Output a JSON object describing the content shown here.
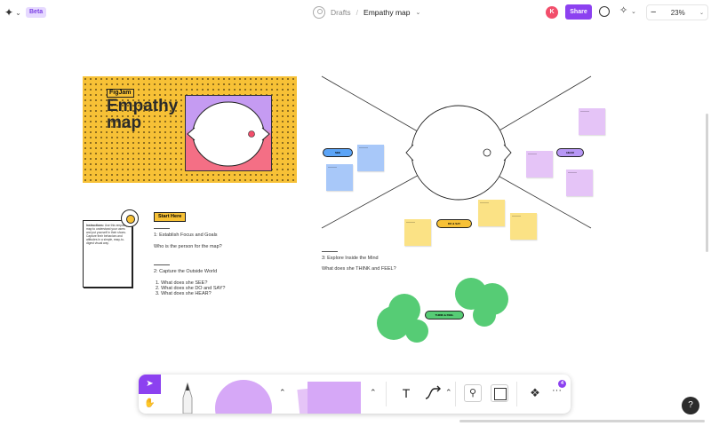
{
  "topbar": {
    "beta": "Beta",
    "breadcrumb": {
      "drafts": "Drafts",
      "separator": "/",
      "title": "Empathy map"
    },
    "user_initial": "K",
    "share": "Share",
    "zoom": "23%"
  },
  "banner": {
    "tag": "FigJam",
    "title": "Empathy map"
  },
  "instructions": {
    "lead": "Instructions:",
    "text": "Use this empathy map to understand your users and put yourself in their shoes. Capture their behaviors and attitudes in a simple, easy-to-digest visual way."
  },
  "steps": {
    "start": "Start Here",
    "step1": "1: Establish Focus and Goals",
    "step1_q": "Who is the person for the map?",
    "step2": "2: Capture the Outside World",
    "step2_items": [
      "1. What does she SEE?",
      "2. What does she DO and SAY?",
      "3. What does she HEAR?"
    ],
    "step3": "3: Explore Inside the Mind",
    "step3_q": "What does she THINK and FEEL?"
  },
  "map": {
    "pill_see": "SEE",
    "pill_hear": "HEAR",
    "pill_do_say": "DO & SAY",
    "pill_think_feel": "THINK & FEEL"
  },
  "colors": {
    "accent": "#8c41f0",
    "banner_yellow": "#f7c136",
    "sticky_blue": "#a8c8f9",
    "sticky_purple": "#e5c4f7",
    "sticky_yellow": "#fbe285",
    "sticky_green": "#56cc75"
  },
  "toolbar": {
    "badge": "4"
  },
  "help": "?"
}
